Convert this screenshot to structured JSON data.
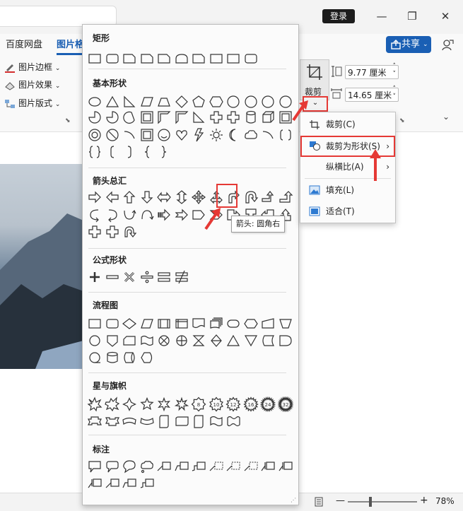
{
  "window": {
    "login_label": "登录",
    "share_label": "共享",
    "min_glyph": "—",
    "max_glyph": "❐",
    "close_glyph": "✕"
  },
  "tabs": [
    {
      "label": "百度网盘"
    },
    {
      "label": "图片格"
    }
  ],
  "ribbon": {
    "border_label": "图片边框",
    "effects_label": "图片效果",
    "layout_label": "图片版式",
    "crop_label": "裁剪",
    "height_value": "9.77 厘米",
    "width_value": "14.65 厘米"
  },
  "gallery": {
    "sections": [
      {
        "title": "矩形"
      },
      {
        "title": "基本形状"
      },
      {
        "title": "箭头总汇"
      },
      {
        "title": "公式形状"
      },
      {
        "title": "流程图"
      },
      {
        "title": "星与旗帜"
      },
      {
        "title": "标注"
      }
    ],
    "tooltip": "箭头: 圆角右"
  },
  "menu": {
    "items": [
      {
        "label": "裁剪(C)"
      },
      {
        "label": "裁剪为形状(S)"
      },
      {
        "label": "纵横比(A)"
      },
      {
        "label": "填充(L)"
      },
      {
        "label": "适合(T)"
      }
    ]
  },
  "status": {
    "zoom": "78%"
  },
  "colors": {
    "accent": "#1a5fb4",
    "highlight": "#e53935"
  }
}
